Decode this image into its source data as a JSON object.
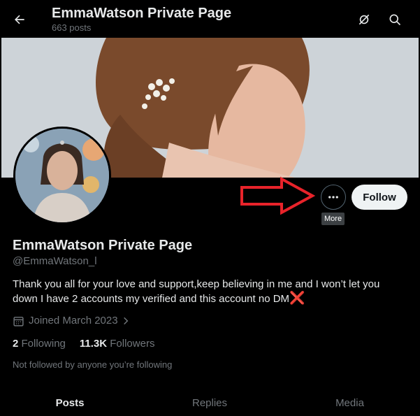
{
  "header": {
    "title": "EmmaWatson Private Page",
    "post_count": "663 posts"
  },
  "profile": {
    "display_name": "EmmaWatson Private Page",
    "handle": "@EmmaWatson_l",
    "bio": "Thank you all for your love and support,keep believing in me and I won’t let you down  I have 2 accounts my verified and this account no DM",
    "bio_emoji": "❌",
    "joined": "Joined March 2023",
    "following_count": "2",
    "following_label": "Following",
    "followers_count": "11.3K",
    "followers_label": "Followers",
    "not_followed_text": "Not followed by anyone you’re following"
  },
  "actions": {
    "more_tooltip": "More",
    "follow_label": "Follow"
  },
  "tabs": [
    {
      "label": "Posts",
      "active": true
    },
    {
      "label": "Replies",
      "active": false
    },
    {
      "label": "Media",
      "active": false
    }
  ],
  "colors": {
    "accent_arrow": "#e8232a",
    "muted_text": "#71767b"
  }
}
